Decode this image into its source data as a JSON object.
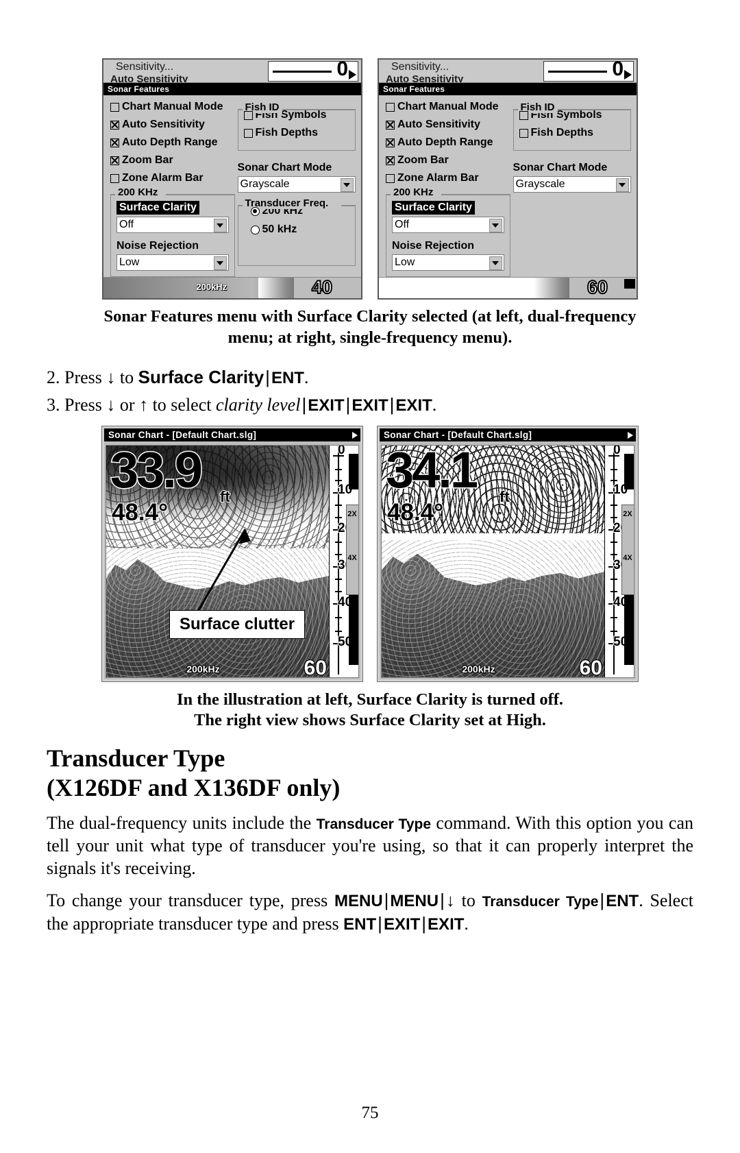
{
  "figure1": {
    "caption": "Sonar Features menu with Surface Clarity selected (at left, dual-frequency menu; at right, single-frequency menu).",
    "left": {
      "header": {
        "sensitivity": "Sensitivity...",
        "auto_sensitivity": "Auto Sensitivity",
        "gauge_value": "0"
      },
      "titlebar": "Sonar Features",
      "checkboxes": [
        {
          "label": "Chart Manual Mode",
          "checked": false
        },
        {
          "label": "Auto Sensitivity",
          "checked": true
        },
        {
          "label": "Auto Depth Range",
          "checked": true
        },
        {
          "label": "Zoom Bar",
          "checked": true
        },
        {
          "label": "Zone Alarm Bar",
          "checked": false
        }
      ],
      "freq_group": {
        "label": "200 KHz",
        "surface_clarity_label": "Surface Clarity",
        "surface_clarity_value": "Off",
        "noise_rejection_label": "Noise Rejection",
        "noise_rejection_value": "Low"
      },
      "fish_id": {
        "label": "Fish ID",
        "options": [
          {
            "label": "Fish Symbols",
            "checked": false
          },
          {
            "label": "Fish Depths",
            "checked": false
          }
        ]
      },
      "sonar_chart_mode": {
        "label": "Sonar Chart Mode",
        "value": "Grayscale"
      },
      "transducer_freq": {
        "label": "Transducer Freq.",
        "options": [
          {
            "label": "200 kHz",
            "selected": true
          },
          {
            "label": "50 kHz",
            "selected": false
          }
        ]
      },
      "footer": {
        "frequency": "200kHz",
        "depth_range": "40"
      }
    },
    "right": {
      "header": {
        "sensitivity": "Sensitivity...",
        "auto_sensitivity": "Auto Sensitivity",
        "gauge_value": "0"
      },
      "titlebar": "Sonar Features",
      "checkboxes": [
        {
          "label": "Chart Manual Mode",
          "checked": false
        },
        {
          "label": "Auto Sensitivity",
          "checked": true
        },
        {
          "label": "Auto Depth Range",
          "checked": true
        },
        {
          "label": "Zoom Bar",
          "checked": true
        },
        {
          "label": "Zone Alarm Bar",
          "checked": false
        }
      ],
      "freq_group": {
        "label": "200 KHz",
        "surface_clarity_label": "Surface Clarity",
        "surface_clarity_value": "Off",
        "noise_rejection_label": "Noise Rejection",
        "noise_rejection_value": "Low"
      },
      "fish_id": {
        "label": "Fish ID",
        "options": [
          {
            "label": "Fish Symbols",
            "checked": false
          },
          {
            "label": "Fish Depths",
            "checked": false
          }
        ]
      },
      "sonar_chart_mode": {
        "label": "Sonar Chart Mode",
        "value": "Grayscale"
      },
      "footer": {
        "frequency": "",
        "depth_range": "60"
      }
    }
  },
  "steps": [
    {
      "number": "2.",
      "lead": "Press",
      "arrow": "↓",
      "mid": "to",
      "target": "Surface Clarity",
      "keys": [
        "ENT"
      ],
      "tail": "."
    },
    {
      "number": "3.",
      "lead": "Press",
      "arrow": "↓",
      "or": "or",
      "arrow2": "↑",
      "mid": "to select",
      "italic": "clarity level",
      "keys": [
        "EXIT",
        "EXIT",
        "EXIT"
      ],
      "tail": "."
    }
  ],
  "figure2": {
    "caption_line1": "In the illustration at left, Surface Clarity is turned off.",
    "caption_line2": "The right view shows Surface Clarity set at High.",
    "left": {
      "titlebar": "Sonar Chart - [Default Chart.slg]",
      "depth": "33.9",
      "depth_unit": "ft",
      "temperature": "48.4°",
      "scale_labels": [
        "0",
        "10",
        "20",
        "30",
        "40",
        "50"
      ],
      "zoom_labels": [
        "2X",
        "4X"
      ],
      "footer_frequency": "200kHz",
      "footer_range": "60",
      "annotation": "Surface clutter"
    },
    "right": {
      "titlebar": "Sonar Chart - [Default Chart.slg]",
      "depth": "34.1",
      "depth_unit": "ft",
      "temperature": "48.4°",
      "scale_labels": [
        "0",
        "10",
        "20",
        "30",
        "40",
        "50"
      ],
      "zoom_labels": [
        "2X",
        "4X"
      ],
      "footer_frequency": "200kHz",
      "footer_range": "60"
    }
  },
  "section": {
    "heading_line1": "Transducer Type",
    "heading_line2": "(X126DF and X136DF only)",
    "para1_a": "The dual-frequency units include the ",
    "para1_sc": "Transducer Type",
    "para1_b": " command. With this option you can tell your unit what type of transducer you're using, so that it can properly interpret the signals it's receiving.",
    "para2_a": "To change your transducer type, press ",
    "para2_k1": "MENU",
    "para2_k2": "MENU",
    "para2_arrow": "↓",
    "para2_b": " to ",
    "para2_sc": "Transducer Type",
    "para2_k3": "ENT",
    "para2_c": ". Select the appropriate transducer type and press ",
    "para2_k4": "ENT",
    "para2_k5": "EXIT",
    "para2_k6": "EXIT",
    "para2_d": "."
  },
  "page_number": "75"
}
